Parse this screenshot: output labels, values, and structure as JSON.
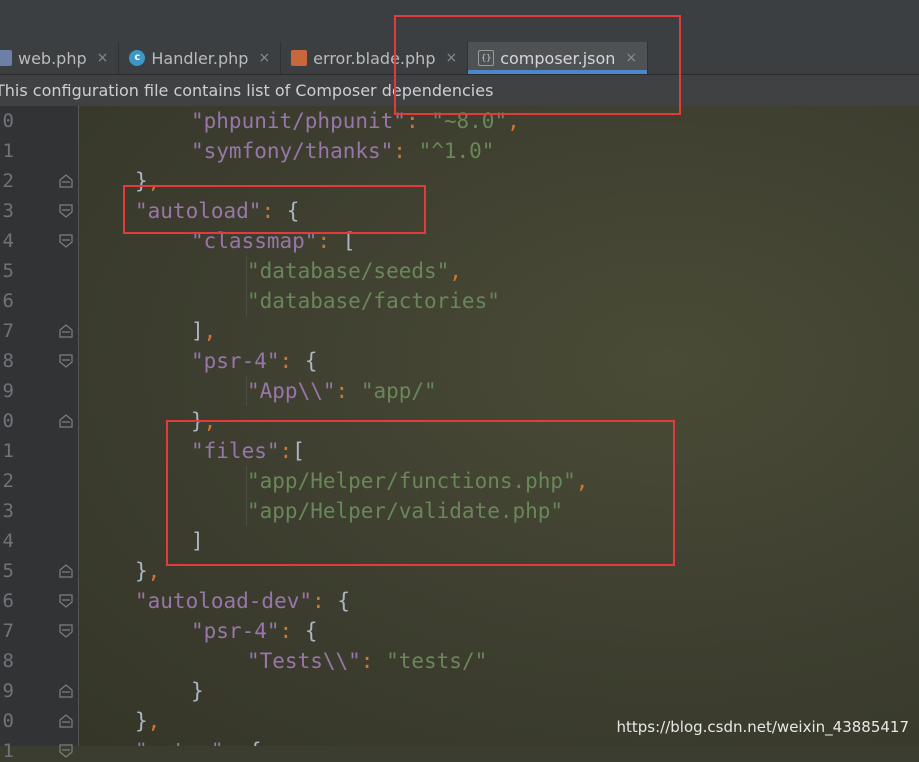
{
  "tabs": [
    {
      "label": "web.php",
      "icon": "php-file-icon"
    },
    {
      "label": "Handler.php",
      "icon": "class-icon"
    },
    {
      "label": "error.blade.php",
      "icon": "blade-file-icon"
    },
    {
      "label": "composer.json",
      "icon": "json-file-icon",
      "active": true
    }
  ],
  "close_glyph": "×",
  "class_icon_letter": "c",
  "json_icon_glyph": "{}",
  "notice": "This configuration file contains list of Composer dependencies",
  "line_numbers": [
    "0",
    "1",
    "2",
    "3",
    "4",
    "5",
    "6",
    "7",
    "8",
    "9",
    "0",
    "1",
    "2",
    "3",
    "4",
    "5",
    "6",
    "7",
    "8",
    "9",
    "0",
    "1"
  ],
  "code": [
    {
      "indent": 2,
      "tokens": [
        [
          "k",
          "\"phpunit/phpunit\""
        ],
        [
          "p",
          ": "
        ],
        [
          "s",
          "\"~8.0\""
        ],
        [
          "p",
          ","
        ]
      ]
    },
    {
      "indent": 2,
      "tokens": [
        [
          "k",
          "\"symfony/thanks\""
        ],
        [
          "p",
          ": "
        ],
        [
          "s",
          "\"^1.0\""
        ]
      ]
    },
    {
      "indent": 1,
      "tokens": [
        [
          "b",
          "}"
        ],
        [
          "p",
          ","
        ]
      ]
    },
    {
      "indent": 1,
      "tokens": [
        [
          "k",
          "\"autoload\""
        ],
        [
          "p",
          ": "
        ],
        [
          "b",
          "{"
        ]
      ]
    },
    {
      "indent": 2,
      "tokens": [
        [
          "k",
          "\"classmap\""
        ],
        [
          "p",
          ": "
        ],
        [
          "b",
          "["
        ]
      ]
    },
    {
      "indent": 3,
      "tokens": [
        [
          "s",
          "\"database/seeds\""
        ],
        [
          "p",
          ","
        ]
      ]
    },
    {
      "indent": 3,
      "tokens": [
        [
          "s",
          "\"database/factories\""
        ]
      ]
    },
    {
      "indent": 2,
      "tokens": [
        [
          "b",
          "]"
        ],
        [
          "p",
          ","
        ]
      ]
    },
    {
      "indent": 2,
      "tokens": [
        [
          "k",
          "\"psr-4\""
        ],
        [
          "p",
          ": "
        ],
        [
          "b",
          "{"
        ]
      ]
    },
    {
      "indent": 3,
      "tokens": [
        [
          "k",
          "\"App\\\\\""
        ],
        [
          "p",
          ": "
        ],
        [
          "s",
          "\"app/\""
        ]
      ]
    },
    {
      "indent": 2,
      "tokens": [
        [
          "b",
          "}"
        ],
        [
          "p",
          ","
        ]
      ]
    },
    {
      "indent": 2,
      "tokens": [
        [
          "k",
          "\"files\""
        ],
        [
          "p",
          ":"
        ],
        [
          "b",
          "["
        ]
      ]
    },
    {
      "indent": 3,
      "tokens": [
        [
          "s",
          "\"app/Helper/functions.php\""
        ],
        [
          "p",
          ","
        ]
      ]
    },
    {
      "indent": 3,
      "tokens": [
        [
          "s",
          "\"app/Helper/validate.php\""
        ]
      ]
    },
    {
      "indent": 2,
      "tokens": [
        [
          "b",
          "]"
        ]
      ]
    },
    {
      "indent": 1,
      "tokens": [
        [
          "b",
          "}"
        ],
        [
          "p",
          ","
        ]
      ]
    },
    {
      "indent": 1,
      "tokens": [
        [
          "k",
          "\"autoload-dev\""
        ],
        [
          "p",
          ": "
        ],
        [
          "b",
          "{"
        ]
      ]
    },
    {
      "indent": 2,
      "tokens": [
        [
          "k",
          "\"psr-4\""
        ],
        [
          "p",
          ": "
        ],
        [
          "b",
          "{"
        ]
      ]
    },
    {
      "indent": 3,
      "tokens": [
        [
          "k",
          "\"Tests\\\\\""
        ],
        [
          "p",
          ": "
        ],
        [
          "s",
          "\"tests/\""
        ]
      ]
    },
    {
      "indent": 2,
      "tokens": [
        [
          "b",
          "}"
        ]
      ]
    },
    {
      "indent": 1,
      "tokens": [
        [
          "b",
          "}"
        ],
        [
          "p",
          ","
        ]
      ]
    },
    {
      "indent": 1,
      "tokens": [
        [
          "k",
          "\"extra\""
        ],
        [
          "p",
          ": "
        ],
        [
          "b",
          "{"
        ]
      ]
    }
  ],
  "colors": {
    "key": "#9876aa",
    "string": "#6a8759",
    "punct": "#cc7832",
    "brace": "#a9b7c6",
    "highlight_box": "#e23b3b",
    "active_tab_underline": "#4a88c7"
  },
  "watermark": "https://blog.csdn.net/weixin_43885417"
}
